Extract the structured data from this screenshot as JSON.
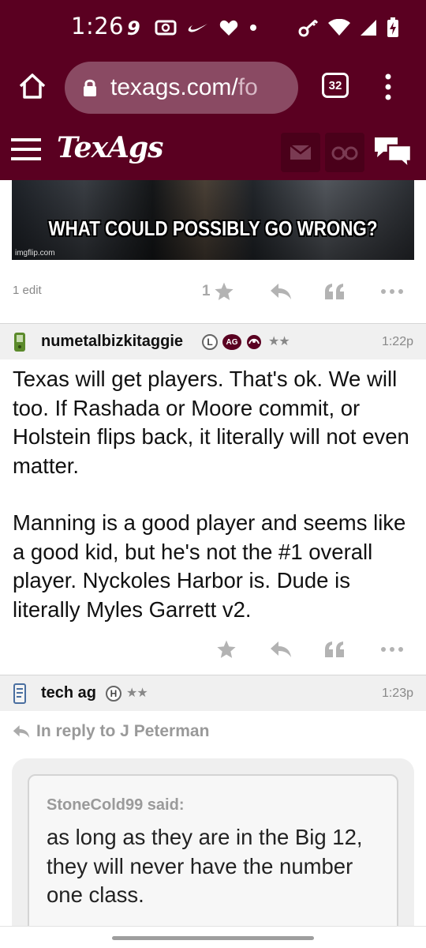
{
  "status_bar": {
    "time": "1:26",
    "left_icons": [
      "nine-app-icon",
      "radio-icon",
      "nike-icon",
      "heart-icon",
      "dot-icon"
    ],
    "right_icons": [
      "key-icon",
      "wifi-icon",
      "signal-icon",
      "battery-charging-icon"
    ]
  },
  "browser": {
    "url_main": "texags.com/",
    "url_tail": "fo",
    "tab_count": "32"
  },
  "site": {
    "logo": "TexAgs"
  },
  "meme": {
    "caption": "WHAT COULD POSSIBLY GO WRONG?",
    "watermark": "imgflip.com"
  },
  "post1_actions": {
    "edit_note": "1 edit",
    "star_count": "1"
  },
  "post2": {
    "username": "numetalbizkitaggie",
    "badge_l": "L",
    "badge_ag": "AG",
    "stars": "★★",
    "time": "1:22p",
    "paragraphs": [
      "Texas will get players. That's ok. We will too. If Rashada or Moore commit, or Holstein flips back, it literally will not even matter.",
      "Manning is a good player and seems like a good kid, but he's not the #1 overall player. Nyckoles Harbor is. Dude is literally Myles Garrett v2."
    ]
  },
  "post3": {
    "username": "tech ag",
    "badge_h": "H",
    "stars": "★★",
    "time": "1:23p",
    "reply_to": "In reply to J Peterman",
    "quote_author": "StoneCold99 said:",
    "quote_text": "as long as they are in the Big 12, they will never have the number one class."
  },
  "colors": {
    "brand_maroon": "#5a0021",
    "url_bar": "#8a4a63",
    "icon_gray": "#b3b3b3"
  }
}
